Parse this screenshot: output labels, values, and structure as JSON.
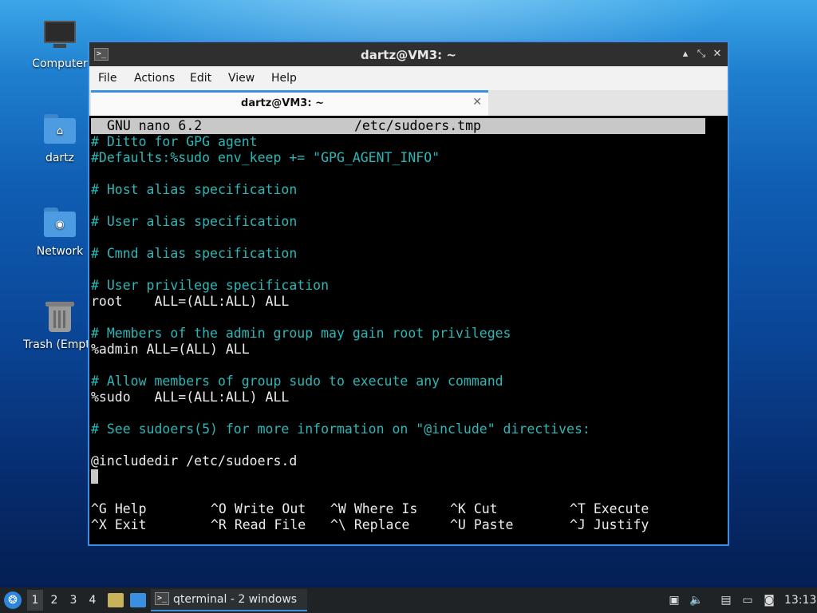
{
  "desktop": {
    "icons": [
      {
        "label": "Computer",
        "icon": "computer-icon"
      },
      {
        "label": "dartz",
        "icon": "home-folder-icon"
      },
      {
        "label": "Network",
        "icon": "network-folder-icon"
      },
      {
        "label": "Trash (Empty)",
        "icon": "trash-icon"
      }
    ]
  },
  "window": {
    "title": "dartz@VM3: ~",
    "controls": {
      "minimize": "▴",
      "maximize": "⤡",
      "close": "✕"
    },
    "menu": [
      "File",
      "Actions",
      "Edit",
      "View",
      "Help"
    ],
    "tab": {
      "label": "dartz@VM3: ~",
      "close": "✕"
    }
  },
  "nano": {
    "version": "GNU nano 6.2",
    "filename": "/etc/sudoers.tmp",
    "lines": [
      {
        "text": "# Ditto for GPG agent",
        "kind": "comment"
      },
      {
        "text": "#Defaults:%sudo env_keep += \"GPG_AGENT_INFO\"",
        "kind": "comment"
      },
      {
        "text": "",
        "kind": "plain"
      },
      {
        "text": "# Host alias specification",
        "kind": "comment"
      },
      {
        "text": "",
        "kind": "plain"
      },
      {
        "text": "# User alias specification",
        "kind": "comment"
      },
      {
        "text": "",
        "kind": "plain"
      },
      {
        "text": "# Cmnd alias specification",
        "kind": "comment"
      },
      {
        "text": "",
        "kind": "plain"
      },
      {
        "text": "# User privilege specification",
        "kind": "comment"
      },
      {
        "text": "root    ALL=(ALL:ALL) ALL",
        "kind": "plain"
      },
      {
        "text": "",
        "kind": "plain"
      },
      {
        "text": "# Members of the admin group may gain root privileges",
        "kind": "comment"
      },
      {
        "text": "%admin ALL=(ALL) ALL",
        "kind": "plain"
      },
      {
        "text": "",
        "kind": "plain"
      },
      {
        "text": "# Allow members of group sudo to execute any command",
        "kind": "comment"
      },
      {
        "text": "%sudo   ALL=(ALL:ALL) ALL",
        "kind": "plain"
      },
      {
        "text": "",
        "kind": "plain"
      },
      {
        "text": "# See sudoers(5) for more information on \"@include\" directives:",
        "kind": "comment"
      },
      {
        "text": "",
        "kind": "plain"
      },
      {
        "text": "@includedir /etc/sudoers.d",
        "kind": "plain"
      }
    ],
    "shortcuts": [
      [
        {
          "key": "^G",
          "label": "Help"
        },
        {
          "key": "^X",
          "label": "Exit"
        }
      ],
      [
        {
          "key": "^O",
          "label": "Write Out"
        },
        {
          "key": "^R",
          "label": "Read File"
        }
      ],
      [
        {
          "key": "^W",
          "label": "Where Is"
        },
        {
          "key": "^\\",
          "label": "Replace"
        }
      ],
      [
        {
          "key": "^K",
          "label": "Cut"
        },
        {
          "key": "^U",
          "label": "Paste"
        }
      ],
      [
        {
          "key": "^T",
          "label": "Execute"
        },
        {
          "key": "^J",
          "label": "Justify"
        }
      ]
    ]
  },
  "taskbar": {
    "workspaces": [
      "1",
      "2",
      "3",
      "4"
    ],
    "active_workspace": "1",
    "task_label": "qterminal - 2 windows",
    "clock": "13:13",
    "tray_icons": [
      "clipboard-icon",
      "volume-icon",
      "notes-icon",
      "network-icon",
      "update-icon"
    ]
  },
  "colors": {
    "accent": "#3b8fe0",
    "comment": "#2bb7b7",
    "terminal_bg": "#000000",
    "nano_header_bg": "#c8c8c8"
  }
}
